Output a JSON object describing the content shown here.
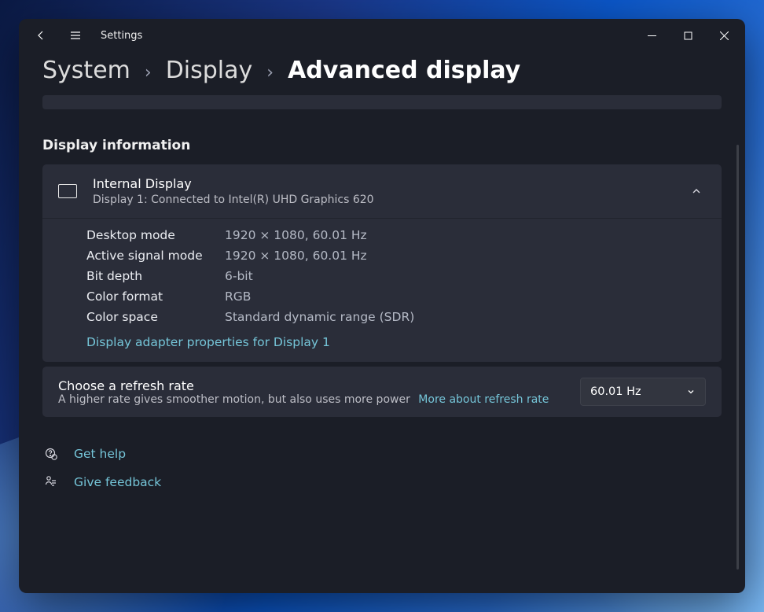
{
  "app": {
    "title": "Settings"
  },
  "breadcrumb": {
    "system": "System",
    "display": "Display",
    "current": "Advanced display"
  },
  "section_heading": "Display information",
  "display_card": {
    "title": "Internal Display",
    "subtitle": "Display 1: Connected to Intel(R) UHD Graphics 620",
    "rows": {
      "desktop_mode": {
        "label": "Desktop mode",
        "value": "1920 × 1080, 60.01 Hz"
      },
      "active_signal_mode": {
        "label": "Active signal mode",
        "value": "1920 × 1080, 60.01 Hz"
      },
      "bit_depth": {
        "label": "Bit depth",
        "value": "6-bit"
      },
      "color_format": {
        "label": "Color format",
        "value": "RGB"
      },
      "color_space": {
        "label": "Color space",
        "value": "Standard dynamic range (SDR)"
      }
    },
    "adapter_link": "Display adapter properties for Display 1"
  },
  "refresh": {
    "title": "Choose a refresh rate",
    "subtitle": "A higher rate gives smoother motion, but also uses more power",
    "more_link": "More about refresh rate",
    "selected": "60.01 Hz"
  },
  "footer": {
    "get_help": "Get help",
    "give_feedback": "Give feedback"
  }
}
